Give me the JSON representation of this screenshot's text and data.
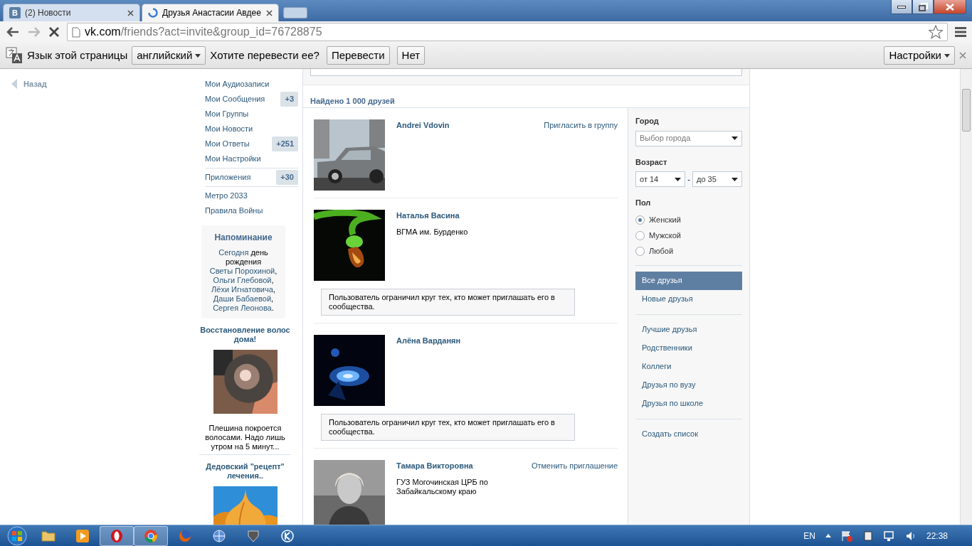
{
  "browser": {
    "tabs": [
      {
        "title": "(2) Новости",
        "selected": false,
        "loading": false,
        "favicon": "В"
      },
      {
        "title": "Друзья Анастасии Авдее",
        "selected": true,
        "loading": true
      }
    ],
    "url": {
      "host": "vk.com",
      "path": "/friends?act=invite&group_id=76728875"
    },
    "loading": true
  },
  "translate_bar": {
    "label": "Язык этой страницы",
    "language": "английский",
    "question": "Хотите перевести ее?",
    "buttons": [
      "Перевести",
      "Нет"
    ],
    "settings": "Настройки"
  },
  "page": {
    "back": "Назад",
    "menu": [
      [
        {
          "label": "Мои Аудиозаписи"
        },
        {
          "label": "Мои Сообщения",
          "badge": "+3"
        },
        {
          "label": "Мои Группы"
        },
        {
          "label": "Мои Новости"
        },
        {
          "label": "Мои Ответы",
          "badge": "+251"
        },
        {
          "label": "Мои Настройки"
        }
      ],
      [
        {
          "label": "Приложения",
          "badge": "+30"
        }
      ],
      [
        {
          "label": "Метро 2033"
        },
        {
          "label": "Правила Войны"
        }
      ]
    ],
    "reminder": {
      "title": "Напоминание",
      "parts": [
        {
          "kind": "link",
          "text": "Сегодня"
        },
        {
          "kind": "text",
          "text": " день рождения "
        },
        {
          "kind": "link",
          "text": "Светы Порохиной"
        },
        {
          "kind": "text",
          "text": ", "
        },
        {
          "kind": "link",
          "text": "Ольги Глебовой"
        },
        {
          "kind": "text",
          "text": ", "
        },
        {
          "kind": "link",
          "text": "Лёхи Игнатовича"
        },
        {
          "kind": "text",
          "text": ", "
        },
        {
          "kind": "link",
          "text": "Даши Бабаевой"
        },
        {
          "kind": "text",
          "text": ", "
        },
        {
          "kind": "link",
          "text": "Сергея Леонова"
        },
        {
          "kind": "text",
          "text": "."
        }
      ]
    },
    "ads": [
      {
        "title": "Восстановление волос дома!",
        "kind": "picture",
        "text": "Плешина покроется волосами. Надо лишь утром на 5 минут..."
      },
      {
        "title": "Дедовский \"рецепт\" лечения..",
        "kind": "picture"
      }
    ],
    "found": "Найдено 1 000 друзей",
    "friends": [
      {
        "name": "Andrei Vdovin",
        "kind": "picture",
        "action": "Пригласить в группу"
      },
      {
        "name": "Наталья Васина",
        "kind": "picture",
        "info": "ВГМА им. Бурденко",
        "notice": "Пользователь ограничил круг тех, кто может приглашать его в сообщества."
      },
      {
        "name": "Алёна Варданян",
        "kind": "picture",
        "notice": "Пользователь ограничил круг тех, кто может приглашать его в сообщества."
      },
      {
        "name": "Тамара Викторовна",
        "kind": "picture",
        "action": "Отменить приглашение",
        "info": "ГУЗ Могочинская ЦРБ по Забайкальскому краю"
      }
    ],
    "filters": {
      "city": {
        "label": "Город",
        "placeholder": "Выбор города"
      },
      "age": {
        "label": "Возраст",
        "from": "от 14",
        "separator": "-",
        "to": "до 35"
      },
      "sex": {
        "label": "Пол",
        "options": [
          {
            "label": "Женский",
            "selected": true
          },
          {
            "label": "Мужской",
            "selected": false
          },
          {
            "label": "Любой",
            "selected": false
          }
        ]
      },
      "lists": [
        [
          {
            "label": "Все друзья",
            "selected": true
          },
          {
            "label": "Новые друзья",
            "selected": false
          }
        ],
        [
          {
            "label": "Лучшие друзья",
            "selected": false
          },
          {
            "label": "Родственники",
            "selected": false
          },
          {
            "label": "Коллеги",
            "selected": false
          },
          {
            "label": "Друзья по вузу",
            "selected": false
          },
          {
            "label": "Друзья по школе",
            "selected": false
          }
        ],
        [
          {
            "label": "Создать список",
            "selected": false
          }
        ]
      ]
    }
  },
  "taskbar": {
    "apps": [
      {
        "kind": "folder",
        "active": false
      },
      {
        "kind": "player",
        "active": false
      },
      {
        "kind": "opera",
        "active": true
      },
      {
        "kind": "chrome",
        "active": true
      },
      {
        "kind": "firefox",
        "active": false
      },
      {
        "kind": "globe",
        "active": false
      },
      {
        "kind": "tank",
        "active": false
      },
      {
        "kind": "game",
        "active": false
      }
    ],
    "language": "EN",
    "clock": "22:38"
  }
}
